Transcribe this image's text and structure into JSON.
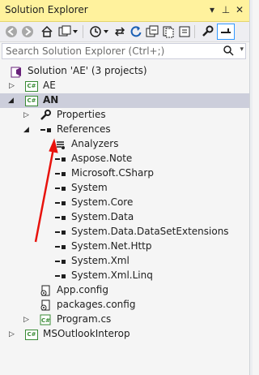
{
  "window": {
    "title": "Solution Explorer",
    "pin_glyph": "▾",
    "pushpin_glyph": "⊥",
    "close_glyph": "✕"
  },
  "toolbar": {
    "icons": [
      "back-icon",
      "forward-icon",
      "home-icon",
      "solution-switch-icon",
      "history-icon",
      "sync-icon",
      "refresh-icon",
      "collapse-all-icon",
      "show-all-files-icon",
      "properties-icon",
      "preview-icon"
    ]
  },
  "search": {
    "placeholder": "Search Solution Explorer (Ctrl+;)"
  },
  "tree": {
    "solution": "Solution 'AE' (3 projects)",
    "projects": {
      "ae": "AE",
      "an": "AN",
      "msoutlookinterop": "MSOutlookInterop"
    },
    "an_children": {
      "properties": "Properties",
      "references": "References",
      "app_config": "App.config",
      "packages_config": "packages.config",
      "program_cs": "Program.cs"
    },
    "references": [
      "Analyzers",
      "Aspose.Note",
      "Microsoft.CSharp",
      "System",
      "System.Core",
      "System.Data",
      "System.Data.DataSetExtensions",
      "System.Net.Http",
      "System.Xml",
      "System.Xml.Linq"
    ]
  },
  "colors": {
    "title_bar": "#fff29d",
    "selected_row": "#cccedb",
    "annotation_arrow": "#e8120c",
    "csharp_green": "#388a34"
  }
}
